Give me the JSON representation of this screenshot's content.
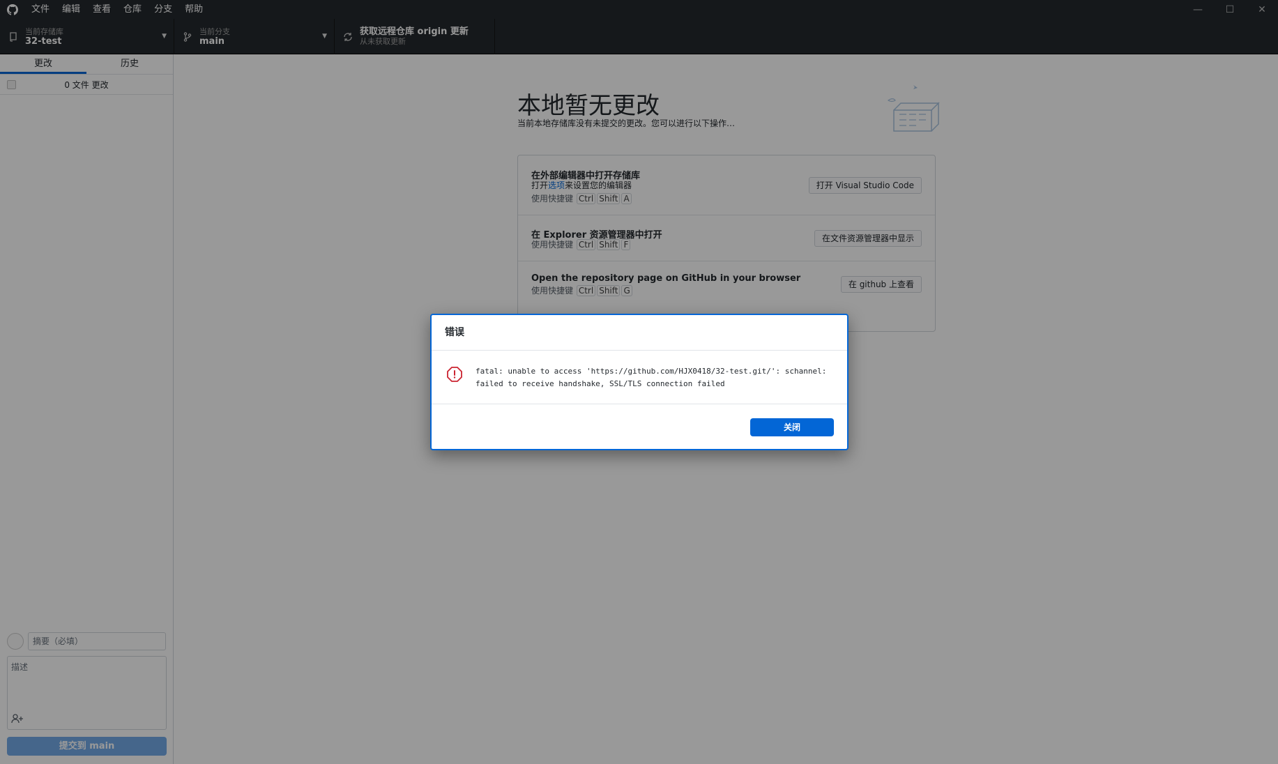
{
  "menu": {
    "items": [
      "文件",
      "编辑",
      "查看",
      "仓库",
      "分支",
      "帮助"
    ]
  },
  "window_controls": {
    "minimize": "—",
    "maximize": "☐",
    "close": "✕"
  },
  "toolbar": {
    "repo": {
      "label": "当前存储库",
      "value": "32-test"
    },
    "branch": {
      "label": "当前分支",
      "value": "main"
    },
    "fetch": {
      "label": "获取远程仓库 origin 更新",
      "value": "从未获取更新"
    }
  },
  "sidebar": {
    "tabs": [
      {
        "label": "更改",
        "active": true
      },
      {
        "label": "历史",
        "active": false
      }
    ],
    "changes_count": "0 文件 更改",
    "commit": {
      "summary_placeholder": "摘要（必填）",
      "description_placeholder": "描述",
      "button": "提交到 main"
    }
  },
  "main": {
    "title": "本地暂无更改",
    "subtitle": "当前本地存储库没有未提交的更改。您可以进行以下操作…",
    "actions": [
      {
        "title": "在外部编辑器中打开存储库",
        "sub_prefix": "打开",
        "sub_link": "选项",
        "sub_suffix": "来设置您的编辑器",
        "shortcut_label": "使用快捷键",
        "keys": [
          "Ctrl",
          "Shift",
          "A"
        ],
        "button": "打开 Visual Studio Code"
      },
      {
        "title": "在 Explorer 资源管理器中打开",
        "shortcut_label": "使用快捷键",
        "keys": [
          "Ctrl",
          "Shift",
          "F"
        ],
        "button": "在文件资源管理器中显示"
      },
      {
        "title": "Open the repository page on GitHub in your browser",
        "shortcut_label": "使用快捷键",
        "keys": [
          "Ctrl",
          "Shift",
          "G"
        ],
        "button": "在 github 上查看"
      }
    ]
  },
  "dialog": {
    "title": "错误",
    "message_line1": "fatal: unable to access 'https://github.com/HJX0418/32-test.git/': schannel:",
    "message_line2": "failed to receive handshake, SSL/TLS connection failed",
    "close_button": "关闭"
  },
  "colors": {
    "accent": "#0366d6",
    "titlebar": "#24292e",
    "error": "#cb2431"
  }
}
